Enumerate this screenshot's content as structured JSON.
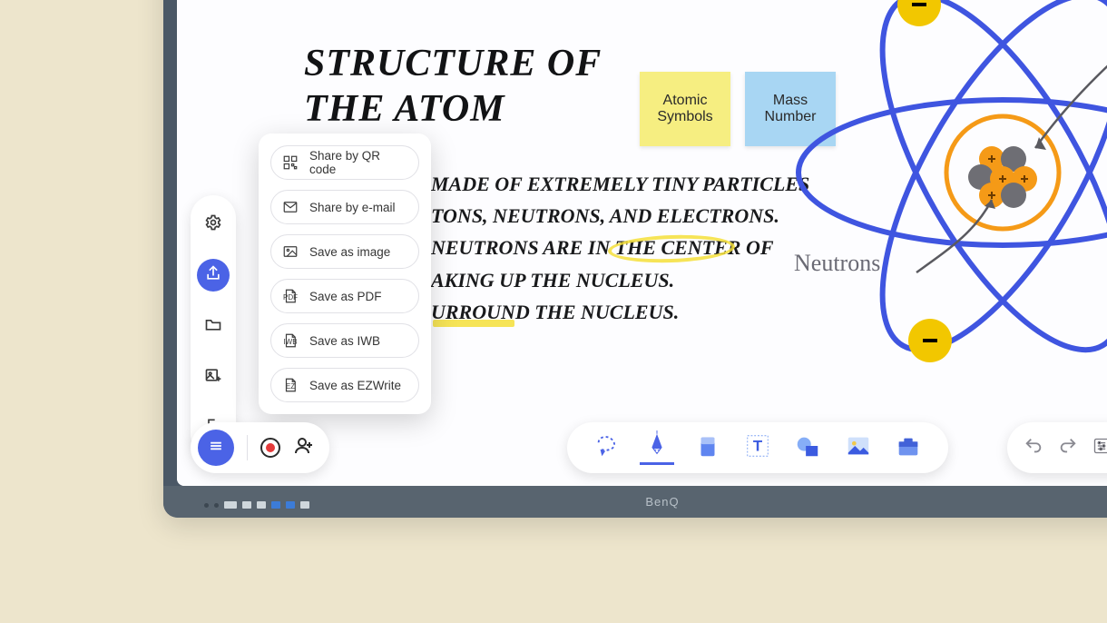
{
  "brand": "BenQ",
  "board": {
    "title": "Structure of\nthe Atom",
    "body": "made of extremely tiny particles\ntons, neutrons, and electrons.\n neutrons are in the center of\naking up the nucleus.\nurround the nucleus.",
    "neutron_label": "Neutrons"
  },
  "stickies": {
    "yellow": "Atomic Symbols",
    "blue": "Mass Number"
  },
  "left_rail": [
    {
      "id": "settings",
      "icon": "gear-icon"
    },
    {
      "id": "share",
      "icon": "share-icon",
      "active": true
    },
    {
      "id": "folder",
      "icon": "folder-icon"
    },
    {
      "id": "import-image",
      "icon": "image-plus-icon"
    },
    {
      "id": "exit",
      "icon": "exit-icon"
    }
  ],
  "share_menu": [
    {
      "id": "qr",
      "label": "Share by QR code",
      "icon": "qr-icon"
    },
    {
      "id": "email",
      "label": "Share by e-mail",
      "icon": "mail-icon"
    },
    {
      "id": "image",
      "label": "Save as image",
      "icon": "image-icon"
    },
    {
      "id": "pdf",
      "label": "Save as PDF",
      "icon": "pdf-icon",
      "badge": "PDF"
    },
    {
      "id": "iwb",
      "label": "Save as IWB",
      "icon": "iwb-icon",
      "badge": "IWB"
    },
    {
      "id": "ez",
      "label": "Save as EZWrite",
      "icon": "ez-icon",
      "badge": "EZ"
    }
  ],
  "bottom_tools": [
    {
      "id": "select",
      "icon": "lasso-icon"
    },
    {
      "id": "pen",
      "icon": "pen-icon"
    },
    {
      "id": "eraser",
      "icon": "eraser-icon"
    },
    {
      "id": "text",
      "icon": "text-icon"
    },
    {
      "id": "shapes",
      "icon": "shapes-icon"
    },
    {
      "id": "image",
      "icon": "picture-icon"
    },
    {
      "id": "briefcase",
      "icon": "briefcase-icon"
    }
  ],
  "bottom_right": {
    "undo": "undo-icon",
    "redo": "redo-icon",
    "settings": "sliders-icon"
  },
  "colors": {
    "accent": "#4b63e6",
    "sticky_yellow": "#f6ee81",
    "sticky_blue": "#a8d6f3",
    "electron_yellow": "#f2c700",
    "proton_orange": "#f59a17",
    "neutron_gray": "#6e6e74",
    "orbit_blue": "#3f55e0"
  }
}
